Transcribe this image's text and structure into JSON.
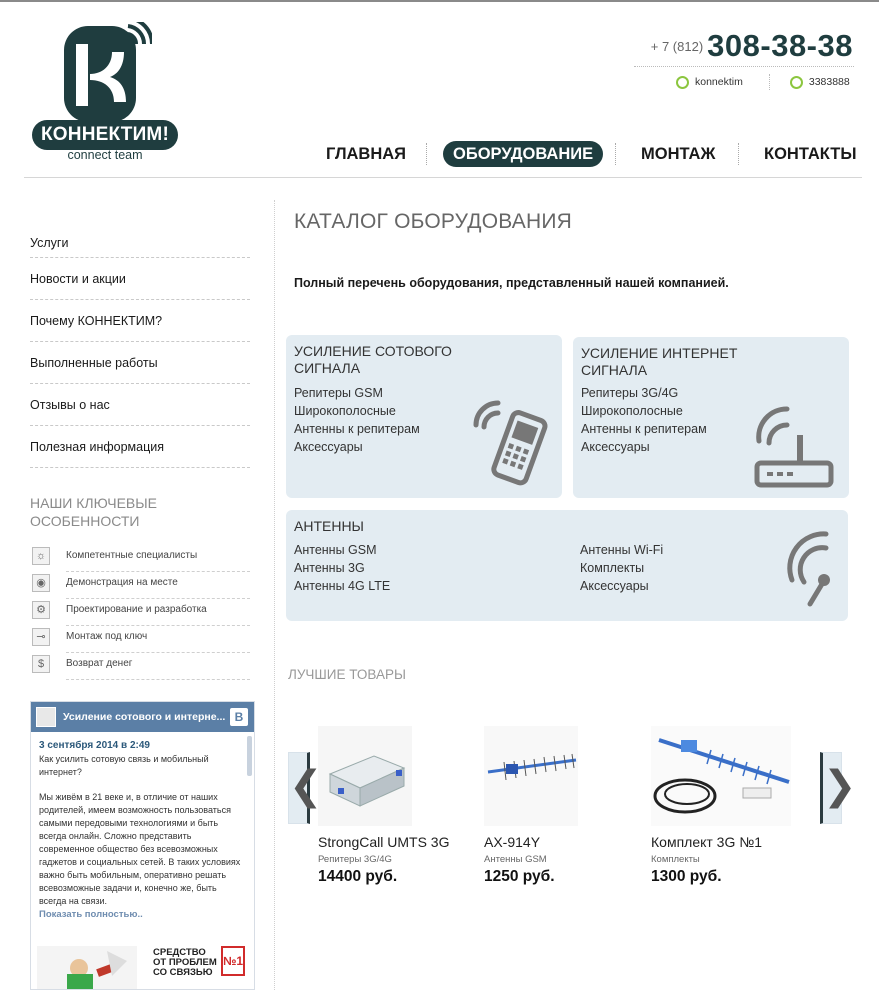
{
  "logo": {
    "name": "КОННЕКТИМ!",
    "tagline": "connect team"
  },
  "header": {
    "phone_prefix": "+ 7 (812)",
    "phone_number": "308-38-38",
    "skype": "konnektim",
    "icq": "3383888"
  },
  "nav": {
    "items": [
      {
        "label": "ГЛАВНАЯ"
      },
      {
        "label": "ОБОРУДОВАНИЕ"
      },
      {
        "label": "МОНТАЖ"
      },
      {
        "label": "КОНТАКТЫ"
      }
    ],
    "active": "ОБОРУДОВАНИЕ"
  },
  "sidebar": {
    "items": [
      {
        "label": "Услуги"
      },
      {
        "label": "Новости и акции"
      },
      {
        "label": "Почему КОННЕКТИМ?"
      },
      {
        "label": "Выполненные работы"
      },
      {
        "label": "Отзывы о нас"
      },
      {
        "label": "Полезная информация"
      }
    ],
    "features_title": "НАШИ КЛЮЧЕВЫЕ ОСОБЕННОСТИ",
    "features": [
      {
        "label": "Компетентные специалисты",
        "icon": "lightbulb-icon"
      },
      {
        "label": "Демонстрация на месте",
        "icon": "eye-icon"
      },
      {
        "label": "Проектирование и разработка",
        "icon": "gear-icon"
      },
      {
        "label": "Монтаж под ключ",
        "icon": "key-icon"
      },
      {
        "label": "Возврат денег",
        "icon": "dollar-icon"
      }
    ]
  },
  "vk_widget": {
    "title": "Усиление сотового и интерне...",
    "badge": "B",
    "date": "3 сентября 2014 в 2:49",
    "question": "Как усилить сотовую связь и мобильный интернет?",
    "text": "Мы живём в 21 веке и, в отличие от наших родителей, имеем возможность пользоваться самыми передовыми технологиями и быть всегда онлайн. Сложно представить современное общество без всевозможных гаджетов и социальных сетей. В таких условиях важно быть мобильным, оперативно решать всевозможные задачи и, конечно же, быть всегда на связи.",
    "more": "Показать полностью..",
    "promo_line1": "СРЕДСТВО",
    "promo_line2": "ОТ ПРОБЛЕМ",
    "promo_line3": "СО СВЯЗЬЮ",
    "promo_badge": "№1"
  },
  "main": {
    "title": "КАТАЛОГ ОБОРУДОВАНИЯ",
    "lead": "Полный перечень оборудования, представленный нашей компанией.",
    "cards": [
      {
        "title_line1": "УСИЛЕНИЕ СОТОВОГО",
        "title_line2": "СИГНАЛА",
        "links": [
          "Репитеры GSM",
          "Широкополосные",
          "Антенны к репитерам",
          "Аксессуары"
        ],
        "icon": "mobile-phone-icon"
      },
      {
        "title_line1": "УСИЛЕНИЕ ИНТЕРНЕТ",
        "title_line2": "СИГНАЛА",
        "links": [
          "Репитеры 3G/4G",
          "Широкополосные",
          "Антенны к репитерам",
          "Аксессуары"
        ],
        "icon": "router-icon"
      },
      {
        "title_line1": "АНТЕННЫ",
        "links_left": [
          "Антенны GSM",
          "Антенны 3G",
          "Антенны 4G LTE"
        ],
        "links_right": [
          "Антенны Wi-Fi",
          "Комплекты",
          "Аксессуары"
        ],
        "icon": "antenna-icon"
      }
    ],
    "best_title": "ЛУЧШИЕ ТОВАРЫ",
    "products": [
      {
        "name": "StrongCall UMTS 3G",
        "category": "Репитеры 3G/4G",
        "price": "14400 руб."
      },
      {
        "name": "AX-914Y",
        "category": "Антенны GSM",
        "price": "1250 руб."
      },
      {
        "name": "Комплект 3G №1",
        "category": "Комплекты",
        "price": "1300 руб."
      }
    ],
    "prev_arrow": "❮",
    "next_arrow": "❯"
  },
  "colors": {
    "brand": "#1f3d3f",
    "card_bg": "#e3ecf2",
    "vk_blue": "#5b7fa6",
    "accent_green": "#8cc63f"
  }
}
